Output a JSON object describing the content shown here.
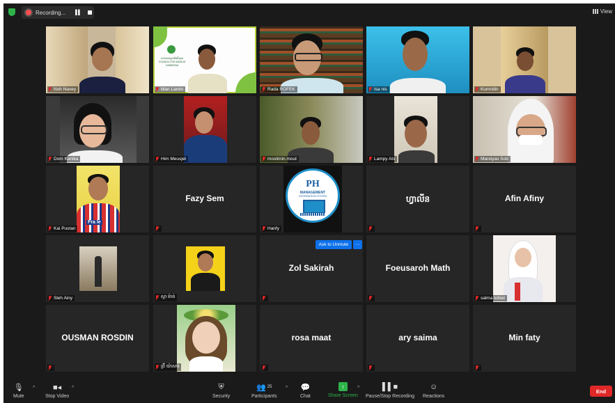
{
  "app": {
    "recording_label": "Recording...",
    "view_label": "View"
  },
  "participants": [
    {
      "name": "Noh Navey"
    },
    {
      "name": "Man Lamin"
    },
    {
      "name": "Rada ROFEK"
    },
    {
      "name": "Isa nis"
    },
    {
      "name": "Kumridin"
    },
    {
      "name": "Dom Kanika"
    },
    {
      "name": "Him Meusjet"
    },
    {
      "name": "moslimin.mout"
    },
    {
      "name": "Lampy Ats"
    },
    {
      "name": "Mareiyas Sob"
    },
    {
      "name": "Kai Pustan"
    },
    {
      "name": "Fazy Sem"
    },
    {
      "name": "Hanfy"
    },
    {
      "name": "ហ្វាលីន"
    },
    {
      "name": "Afin Afiny"
    },
    {
      "name": "Sleh Ainy"
    },
    {
      "name": "ស្លា ម៉ាត់"
    },
    {
      "name": "Zol Sakirah"
    },
    {
      "name": "Foeusaroh Math"
    },
    {
      "name": "salma tohiet"
    },
    {
      "name": "OUSMAN ROSDIN"
    },
    {
      "name": "ជ្រឺ យ៉ាសម៉"
    },
    {
      "name": "rosa maat"
    },
    {
      "name": "ary saima"
    },
    {
      "name": "Min faty"
    }
  ],
  "hanfy_logo": {
    "line1": "PH",
    "line2": "MANAGEMENT",
    "line3": "INFORMATION SYSTEM"
  },
  "man_lamin_banner": {
    "line1": "សមាគមកម្ពុជានិងអ៊ីស្លាម",
    "line2": "COUNCIL FOR MUSLIM",
    "line3": "CAMBODIA"
  },
  "kai_shirt_text": "Fra le",
  "ask_to_unmute": "Ask to Unmute",
  "more_label": "···",
  "toolbar": {
    "mute": "Mute",
    "stop_video": "Stop Video",
    "security": "Security",
    "participants": "Participants",
    "participants_count": "25",
    "chat": "Chat",
    "share_screen": "Share Screen",
    "pause_stop_recording": "Pause/Stop Recording",
    "reactions": "Reactions",
    "end": "End"
  },
  "colors": {
    "accent_green": "#2db34a",
    "end_red": "#e02828",
    "unmute_blue": "#0e71eb",
    "active_speaker": "#b6d33a"
  }
}
